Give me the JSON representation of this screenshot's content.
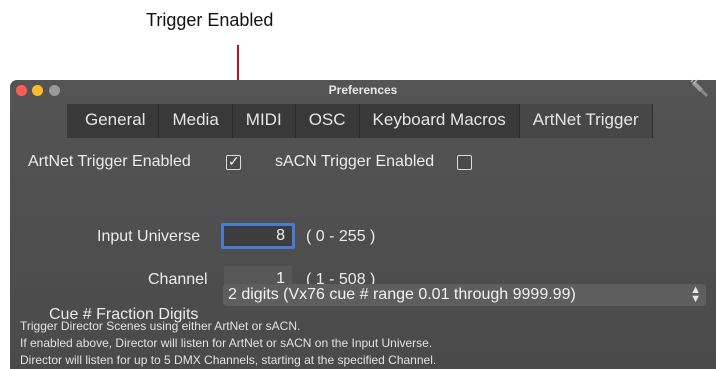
{
  "annotation": {
    "label": "Trigger Enabled"
  },
  "window": {
    "title": "Preferences"
  },
  "tabs": [
    {
      "label": "General",
      "active": false
    },
    {
      "label": "Media",
      "active": false
    },
    {
      "label": "MIDI",
      "active": false
    },
    {
      "label": "OSC",
      "active": false
    },
    {
      "label": "Keyboard Macros",
      "active": false
    },
    {
      "label": "ArtNet Trigger",
      "active": true
    }
  ],
  "artnet_trigger": {
    "label": "ArtNet Trigger Enabled",
    "checked": true
  },
  "sacn_trigger": {
    "label": "sACN Trigger Enabled",
    "checked": false
  },
  "input_universe": {
    "label": "Input Universe",
    "value": "8",
    "range": "( 0 - 255 )"
  },
  "channel": {
    "label": "Channel",
    "value": "1",
    "range": "( 1 - 508 )"
  },
  "cue_fraction": {
    "label": "Cue # Fraction Digits",
    "selected": "2 digits (Vx76 cue # range 0.01 through 9999.99)"
  },
  "help_lines": [
    "Trigger Director Scenes using either ArtNet or sACN.",
    "If enabled above, Director will listen for ArtNet or sACN on the Input Universe.",
    "Director will listen for up to 5 DMX Channels, starting at the specified Channel."
  ],
  "icons": {
    "close": "close-dot",
    "minimize": "minimize-dot",
    "zoom": "zoom-dot",
    "corner": "plug-icon",
    "check": "checkmark-icon",
    "arrows": "updown-arrows-icon"
  }
}
